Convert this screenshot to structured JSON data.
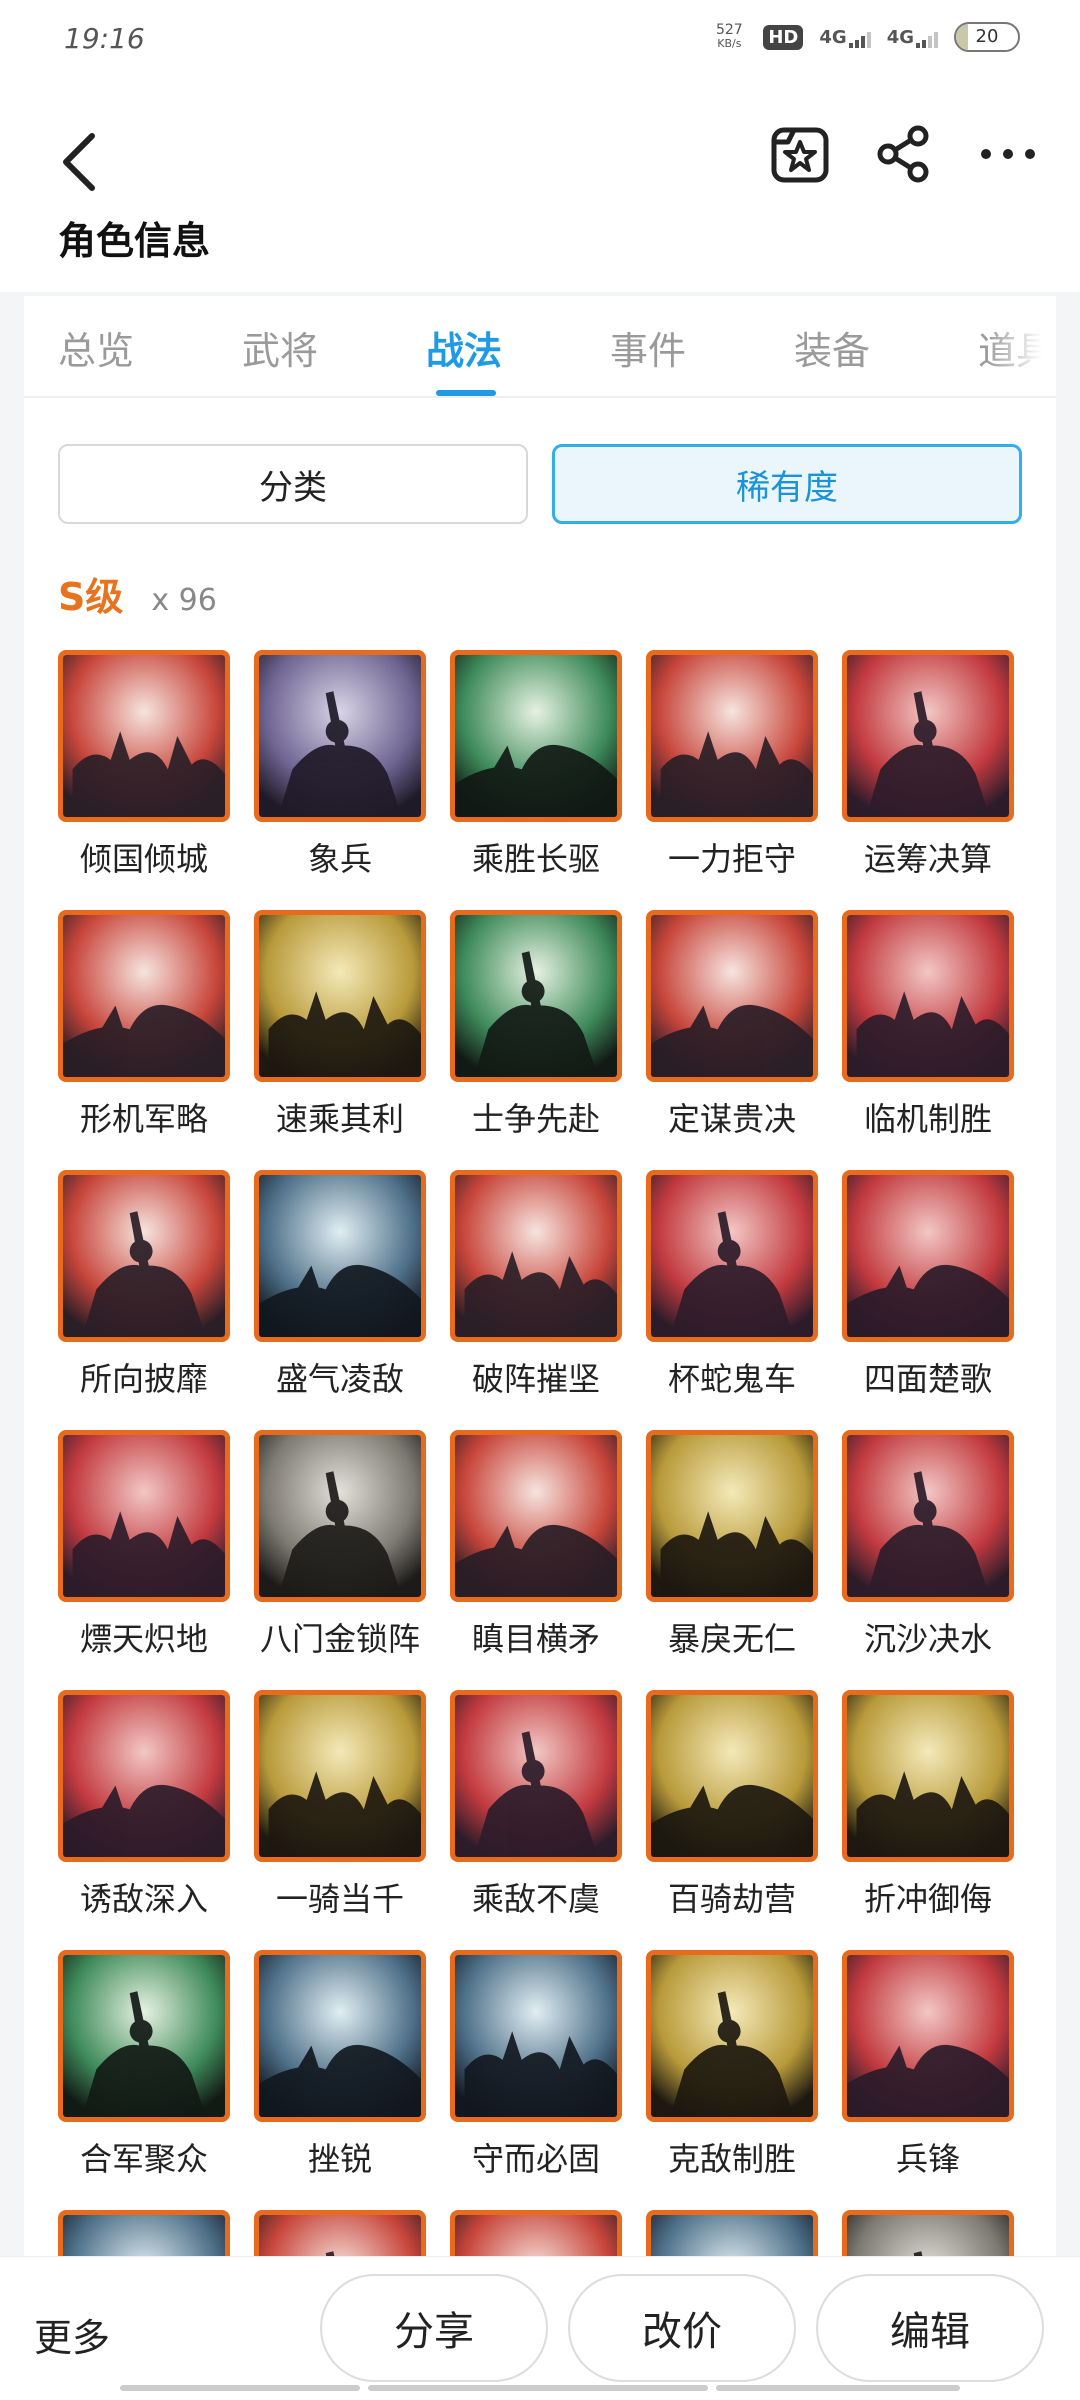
{
  "status_bar": {
    "time": "19:16",
    "net_speed_value": "527",
    "net_speed_unit": "KB/s",
    "hd_badge": "HD",
    "sim1": "4G",
    "sim2": "4G",
    "battery": "20"
  },
  "header": {
    "title": "角色信息",
    "back_icon": "chevron-left-icon",
    "favorite_icon": "star-bookmark-icon",
    "share_icon": "share-icon",
    "more_icon": "more-dots-icon"
  },
  "tabs": [
    {
      "label": "总览",
      "active": false
    },
    {
      "label": "武将",
      "active": false
    },
    {
      "label": "战法",
      "active": true
    },
    {
      "label": "事件",
      "active": false
    },
    {
      "label": "装备",
      "active": false
    },
    {
      "label": "道具",
      "active": false
    }
  ],
  "filters": {
    "category": "分类",
    "rarity": "稀有度",
    "selected": "rarity"
  },
  "grade": {
    "label": "S级",
    "count": "x 96"
  },
  "skills": [
    {
      "name": "倾国倾城",
      "theme": "red"
    },
    {
      "name": "象兵",
      "theme": "purple"
    },
    {
      "name": "乘胜长驱",
      "theme": "green"
    },
    {
      "name": "一力拒守",
      "theme": "red"
    },
    {
      "name": "运筹决算",
      "theme": "crimson"
    },
    {
      "name": "形机军略",
      "theme": "red"
    },
    {
      "name": "速乘其利",
      "theme": "gold"
    },
    {
      "name": "士争先赴",
      "theme": "green"
    },
    {
      "name": "定谋贵决",
      "theme": "red"
    },
    {
      "name": "临机制胜",
      "theme": "crimson"
    },
    {
      "name": "所向披靡",
      "theme": "red"
    },
    {
      "name": "盛气凌敌",
      "theme": "blue"
    },
    {
      "name": "破阵摧坚",
      "theme": "red"
    },
    {
      "name": "杯蛇鬼车",
      "theme": "crimson"
    },
    {
      "name": "四面楚歌",
      "theme": "crimson"
    },
    {
      "name": "熛天炽地",
      "theme": "crimson"
    },
    {
      "name": "八门金锁阵",
      "theme": "gray"
    },
    {
      "name": "瞋目横矛",
      "theme": "red"
    },
    {
      "name": "暴戾无仁",
      "theme": "gold"
    },
    {
      "name": "沉沙决水",
      "theme": "crimson"
    },
    {
      "name": "诱敌深入",
      "theme": "crimson"
    },
    {
      "name": "一骑当千",
      "theme": "gold"
    },
    {
      "name": "乘敌不虞",
      "theme": "crimson"
    },
    {
      "name": "百骑劫营",
      "theme": "gold"
    },
    {
      "name": "折冲御侮",
      "theme": "gold"
    },
    {
      "name": "合军聚众",
      "theme": "green"
    },
    {
      "name": "挫锐",
      "theme": "blue"
    },
    {
      "name": "守而必固",
      "theme": "blue"
    },
    {
      "name": "克敌制胜",
      "theme": "gold"
    },
    {
      "name": "兵锋",
      "theme": "crimson"
    },
    {
      "name": "",
      "theme": "blue"
    },
    {
      "name": "",
      "theme": "red"
    },
    {
      "name": "",
      "theme": "red"
    },
    {
      "name": "",
      "theme": "blue"
    },
    {
      "name": "",
      "theme": "gray"
    }
  ],
  "themes": {
    "red": [
      "#f6e4df",
      "#c7453a",
      "#2a1e27"
    ],
    "crimson": [
      "#f2c7c4",
      "#c23a3f",
      "#2c1c2a"
    ],
    "purple": [
      "#d8d4e6",
      "#6e6592",
      "#1f1a28"
    ],
    "green": [
      "#e6f2e2",
      "#3e8a5a",
      "#121a15"
    ],
    "gold": [
      "#f4e9b8",
      "#b89a3a",
      "#1d1810"
    ],
    "blue": [
      "#e1eef2",
      "#4d6f88",
      "#121820"
    ],
    "gray": [
      "#e3e0da",
      "#7d7a72",
      "#1d1b19"
    ]
  },
  "bottom_bar": {
    "more": "更多",
    "share": "分享",
    "price": "改价",
    "edit": "编辑"
  },
  "colors": {
    "accent": "#1e9ae6",
    "grade": "#e8731e",
    "icon_border": "#e86a1c"
  }
}
